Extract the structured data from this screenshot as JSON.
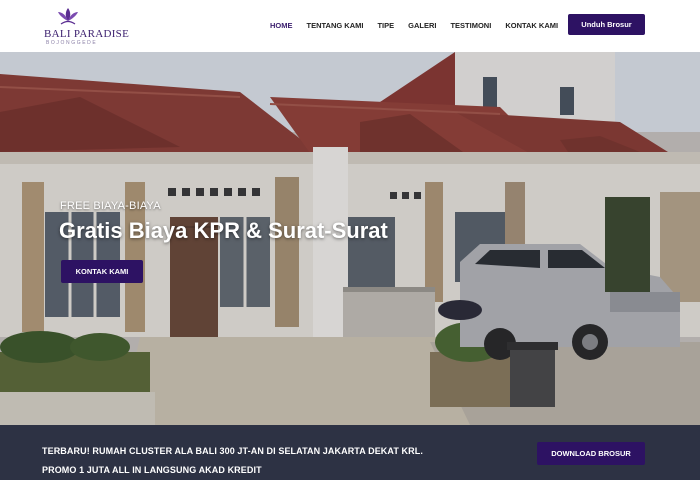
{
  "brand": {
    "name": "BALI PARADISE",
    "subtitle": "BOJONGGEDE",
    "accent_color": "#2d1263",
    "logo_icon": "lotus-icon"
  },
  "nav": {
    "items": [
      {
        "label": "HOME",
        "active": true
      },
      {
        "label": "TENTANG KAMI",
        "active": false
      },
      {
        "label": "TIPE",
        "active": false
      },
      {
        "label": "GALERI",
        "active": false
      },
      {
        "label": "TESTIMONI",
        "active": false
      },
      {
        "label": "KONTAK KAMI",
        "active": false
      }
    ],
    "cta_label": "Unduh Brosur"
  },
  "hero": {
    "eyebrow": "FREE BIAYA-BIAYA",
    "title": "Gratis Biaya KPR & Surat-Surat",
    "button_label": "KONTAK KAMI"
  },
  "promo": {
    "text": "TERBARU! RUMAH CLUSTER ALA BALI 300 JT-AN DI SELATAN JAKARTA DEKAT KRL. PROMO 1 JUTA ALL IN LANGSUNG AKAD KREDIT",
    "button_label": "DOWNLOAD BROSUR",
    "bar_color": "#2d3244"
  }
}
